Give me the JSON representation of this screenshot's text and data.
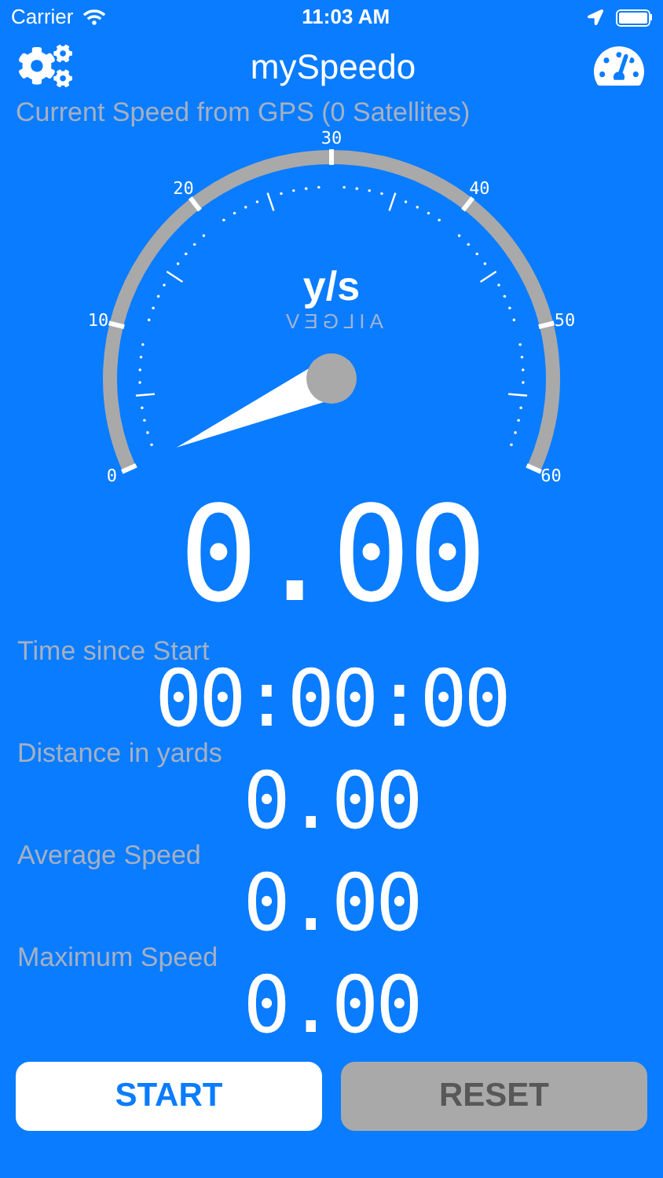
{
  "status_bar": {
    "carrier": "Carrier",
    "time": "11:03 AM"
  },
  "header": {
    "title": "mySpeedo"
  },
  "gps_label": "Current Speed from GPS (0 Satellites)",
  "gauge": {
    "unit": "y/s",
    "brand": "AILGEV",
    "scale_labels": [
      "0",
      "10",
      "20",
      "30",
      "40",
      "50",
      "60"
    ]
  },
  "current_speed": "0.00",
  "stats": [
    {
      "label": "Time since Start",
      "value": "00:00:00"
    },
    {
      "label": "Distance in yards",
      "value": "0.00"
    },
    {
      "label": "Average Speed",
      "value": "0.00"
    },
    {
      "label": "Maximum Speed",
      "value": "0.00"
    }
  ],
  "buttons": [
    {
      "label": "START",
      "kind": "primary"
    },
    {
      "label": "RESET",
      "kind": "secondary"
    }
  ]
}
